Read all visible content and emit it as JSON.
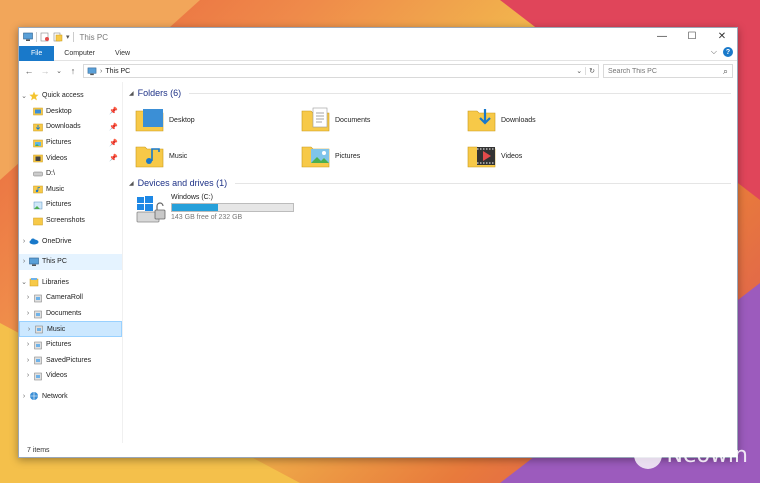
{
  "window": {
    "title": "This PC",
    "controls": {
      "minimize": "—",
      "maximize": "☐",
      "close": "✕"
    }
  },
  "ribbon": {
    "tabs": [
      "File",
      "Computer",
      "View"
    ],
    "expand": "⌵",
    "help": "?"
  },
  "navbar": {
    "back": "←",
    "forward": "→",
    "recent": "⌄",
    "up": "↑",
    "address_sep": "›",
    "address": "This PC",
    "dropdown": "⌄",
    "refresh": "↻",
    "search_placeholder": "Search This PC",
    "search_icon": "⌕"
  },
  "sidebar": {
    "quick_access": {
      "label": "Quick access",
      "items": [
        {
          "label": "Desktop",
          "pinned": true,
          "icon": "desktop-folder-icon"
        },
        {
          "label": "Downloads",
          "pinned": true,
          "icon": "downloads-folder-icon"
        },
        {
          "label": "Pictures",
          "pinned": true,
          "icon": "pictures-folder-icon"
        },
        {
          "label": "Videos",
          "pinned": true,
          "icon": "videos-folder-icon"
        },
        {
          "label": "D:\\",
          "pinned": false,
          "icon": "drive-icon"
        },
        {
          "label": "Music",
          "pinned": false,
          "icon": "music-folder-icon"
        },
        {
          "label": "Pictures",
          "pinned": false,
          "icon": "pictures-library-icon"
        },
        {
          "label": "Screenshots",
          "pinned": false,
          "icon": "folder-icon"
        }
      ]
    },
    "onedrive": "OneDrive",
    "this_pc": "This PC",
    "libraries": {
      "label": "Libraries",
      "items": [
        "CameraRoll",
        "Documents",
        "Music",
        "Pictures",
        "SavedPictures",
        "Videos"
      ]
    },
    "network": "Network",
    "pin_glyph": "📌",
    "chev_expanded": "⌄",
    "chev_collapsed": "›"
  },
  "content": {
    "folders_header": "Folders (6)",
    "folders": [
      "Desktop",
      "Documents",
      "Downloads",
      "Music",
      "Pictures",
      "Videos"
    ],
    "drives_header": "Devices and drives (1)",
    "drive": {
      "name": "Windows (C:)",
      "free_text": "143 GB free of 232 GB",
      "used_fraction": 0.38
    },
    "collapse_glyph": "◢"
  },
  "status": {
    "items": "7 items"
  },
  "watermark": "Neowin",
  "colors": {
    "accent": "#1979ca",
    "folder": "#f7c948",
    "bar_fill": "#26a0da",
    "group_header": "#1e3287"
  }
}
